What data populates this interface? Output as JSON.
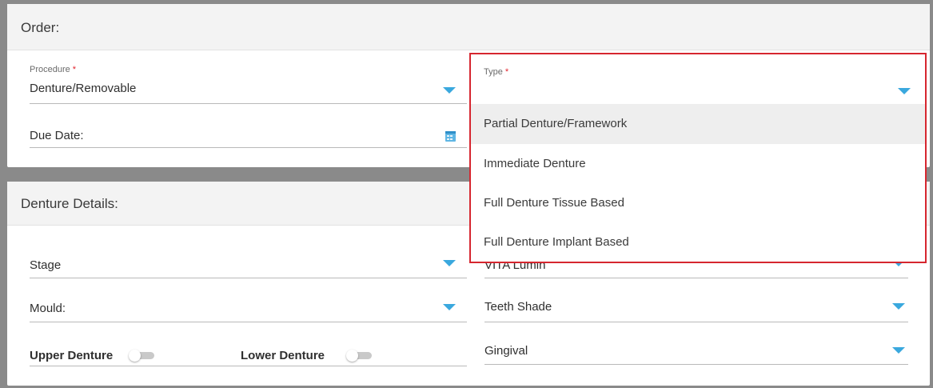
{
  "order": {
    "header": "Order:",
    "procedure": {
      "label": "Procedure",
      "required_mark": "*",
      "value": "Denture/Removable",
      "icon": "chevron-down-icon"
    },
    "due_date": {
      "value": "Due Date:",
      "icon": "calendar-icon"
    },
    "type": {
      "label": "Type",
      "required_mark": "*",
      "value": "",
      "icon": "chevron-down-icon"
    }
  },
  "type_dropdown": {
    "options": [
      "Partial Denture/Framework",
      "Immediate Denture",
      "Full Denture Tissue Based",
      "Full Denture Implant Based"
    ],
    "highlighted_index": 0
  },
  "denture_details": {
    "header": "Denture Details:",
    "stage": "Stage",
    "tooth_material_partial": "VITA Lumin",
    "mould": "Mould:",
    "teeth_shade": "Teeth Shade",
    "upper_denture": "Upper Denture",
    "lower_denture": "Lower Denture",
    "gingival": "Gingival",
    "upper_denture_on": false,
    "lower_denture_on": false
  },
  "colors": {
    "accent": "#3aa8de",
    "required": "#e2262f",
    "dropdown_border": "#d6262f",
    "highlight": "#eeeeee"
  }
}
